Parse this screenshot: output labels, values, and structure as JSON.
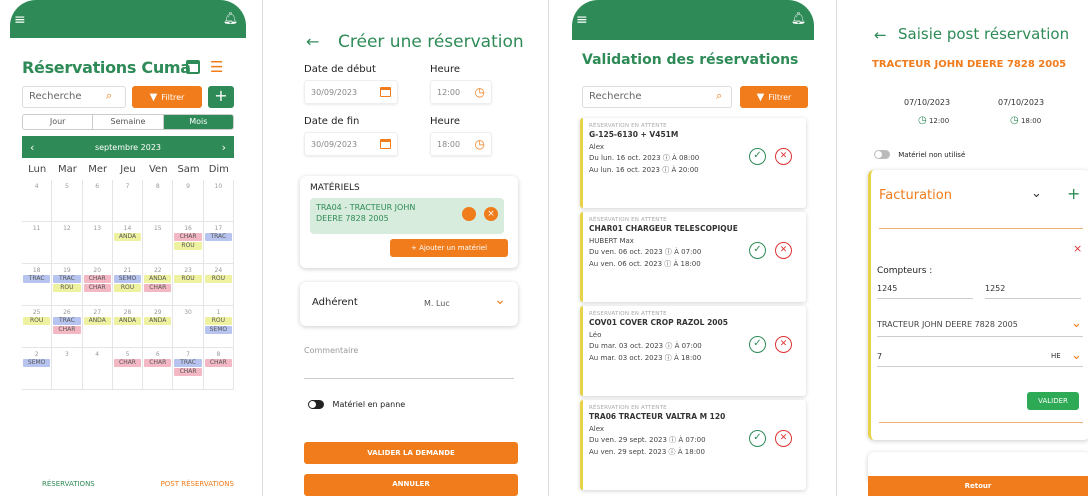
{
  "phone1": {
    "title": "Réservations Cuma",
    "search_placeholder": "Recherche",
    "filter_label": "Filtrer",
    "add_label": "+",
    "tabs": [
      "Jour",
      "Semaine",
      "Mois"
    ],
    "month_label": "septembre 2023",
    "day_names": [
      "Lun",
      "Mar",
      "Mer",
      "Jeu",
      "Ven",
      "Sam",
      "Dim"
    ],
    "weeks": [
      [
        {
          "d": "4"
        },
        {
          "d": "5"
        },
        {
          "d": "6"
        },
        {
          "d": "7"
        },
        {
          "d": "8"
        },
        {
          "d": "9"
        },
        {
          "d": "10"
        }
      ],
      [
        {
          "d": "11"
        },
        {
          "d": "12"
        },
        {
          "d": "13"
        },
        {
          "d": "14",
          "ev": [
            [
              "ANDA",
              "yel"
            ]
          ]
        },
        {
          "d": "15"
        },
        {
          "d": "16",
          "ev": [
            [
              "CHAR",
              "pink"
            ],
            [
              "ROU",
              "yel"
            ]
          ]
        },
        {
          "d": "17",
          "ev": [
            [
              "TRAC",
              "blu"
            ]
          ]
        }
      ],
      [
        {
          "d": "18",
          "ev": [
            [
              "TRAC",
              "blu"
            ]
          ]
        },
        {
          "d": "19",
          "ev": [
            [
              "TRAC",
              "blu"
            ],
            [
              "ROU",
              "yel"
            ]
          ]
        },
        {
          "d": "20",
          "ev": [
            [
              "CHAR",
              "pink"
            ],
            [
              "CHAR",
              "pink"
            ]
          ]
        },
        {
          "d": "21",
          "ev": [
            [
              "SEMO",
              "blu"
            ],
            [
              "ROU",
              "yel"
            ]
          ]
        },
        {
          "d": "22",
          "ev": [
            [
              "ANDA",
              "yel"
            ],
            [
              "CHAR",
              "pink"
            ]
          ]
        },
        {
          "d": "23",
          "ev": [
            [
              "ROU",
              "yel"
            ]
          ]
        },
        {
          "d": "24",
          "ev": [
            [
              "ROU",
              "yel"
            ]
          ]
        }
      ],
      [
        {
          "d": "25",
          "ev": [
            [
              "ROU",
              "yel"
            ]
          ]
        },
        {
          "d": "26",
          "ev": [
            [
              "TRAC",
              "blu"
            ],
            [
              "CHAR",
              "pink"
            ]
          ]
        },
        {
          "d": "27",
          "ev": [
            [
              "ANDA",
              "yel"
            ]
          ]
        },
        {
          "d": "28",
          "ev": [
            [
              "ANDA",
              "yel"
            ]
          ]
        },
        {
          "d": "29",
          "ev": [
            [
              "ANDA",
              "yel"
            ]
          ]
        },
        {
          "d": "30"
        },
        {
          "d": "1",
          "ev": [
            [
              "ROU",
              "yel"
            ],
            [
              "SEMO",
              "blu"
            ]
          ]
        }
      ],
      [
        {
          "d": "2",
          "ev": [
            [
              "SEMO",
              "blu"
            ]
          ]
        },
        {
          "d": "3"
        },
        {
          "d": "4"
        },
        {
          "d": "5",
          "ev": [
            [
              "CHAR",
              "pink"
            ]
          ]
        },
        {
          "d": "6",
          "ev": [
            [
              "CHAR",
              "pink"
            ]
          ]
        },
        {
          "d": "7",
          "ev": [
            [
              "TRAC",
              "blu"
            ],
            [
              "CHAR",
              "pink"
            ]
          ]
        },
        {
          "d": "8",
          "ev": [
            [
              "CHAR",
              "pink"
            ]
          ]
        }
      ]
    ],
    "bottom_tabs": [
      "RÉSERVATIONS",
      "POST RÉSERVATIONS"
    ]
  },
  "phone2": {
    "header": "Créer une réservation",
    "start_date_label": "Date de début",
    "start_date": "30/09/2023",
    "start_time_label": "Heure",
    "start_time": "12:00",
    "end_date_label": "Date de fin",
    "end_date": "30/09/2023",
    "end_time_label": "Heure",
    "end_time": "18:00",
    "materials_label": "MATÉRIELS",
    "material_line1": "TRA04 - TRACTEUR JOHN",
    "material_line2": "DEERE 7828 2005",
    "add_material": "+ Ajouter un matériel",
    "member_label": "Adhérent",
    "member_value": "M. Luc",
    "comment_placeholder": "Commentaire",
    "broken_label": "Matériel en panne",
    "validate": "VALIDER LA DEMANDE",
    "cancel": "ANNULER"
  },
  "phone3": {
    "title": "Validation des réservations",
    "search_placeholder": "Recherche",
    "filter_label": "Filtrer",
    "cards": [
      {
        "status": "RÉSERVATION EN ATTENTE",
        "name": "G-125-6130 + V451M",
        "user": "Alex",
        "from": "Du lun. 16 oct. 2023 ⓘ À 08:00",
        "to": "Au lun. 16 oct. 2023 ⓘ À 20:00"
      },
      {
        "status": "RÉSERVATION EN ATTENTE",
        "name": "CHAR01 CHARGEUR TELESCOPIQUE",
        "user": "HUBERT Max",
        "from": "Du ven. 06 oct. 2023 ⓘ À 07:00",
        "to": "Au ven. 06 oct. 2023 ⓘ À 18:00"
      },
      {
        "status": "RÉSERVATION EN ATTENTE",
        "name": "COV01 COVER CROP RAZOL 2005",
        "user": "Léo",
        "from": "Du mar. 03 oct. 2023 ⓘ À 07:00",
        "to": "Au mar. 03 oct. 2023 ⓘ À 18:00"
      },
      {
        "status": "RÉSERVATION EN ATTENTE",
        "name": "TRA06 TRACTEUR VALTRA M 120",
        "user": "Alex",
        "from": "Du ven. 29 sept. 2023 ⓘ À 07:00",
        "to": "Au ven. 29 sept. 2023 ⓘ À 18:00"
      }
    ]
  },
  "phone4": {
    "header": "Saisie post réservation",
    "machine": "TRACTEUR JOHN DEERE 7828 2005",
    "date_from": "07/10/2023",
    "date_to": "07/10/2023",
    "time_from": "12:00",
    "time_to": "18:00",
    "unused_label": "Matériel non utilisé",
    "billing_label": "Facturation",
    "counters_label": "Compteurs :",
    "counter_from": "1245",
    "counter_to": "1252",
    "machine_select": "TRACTEUR JOHN DEERE 7828 2005",
    "quantity": "7",
    "unit": "HE",
    "validate": "VALIDER",
    "back": "Retour"
  },
  "colors": {
    "green": "#2e8b57",
    "orange": "#f07c1c"
  }
}
